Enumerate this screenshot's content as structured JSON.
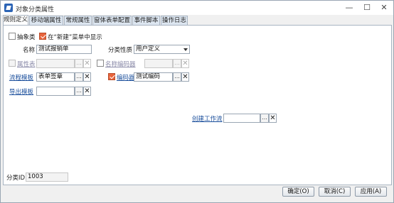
{
  "window": {
    "title": "对象分类属性",
    "minimize_symbol": "—",
    "maximize_symbol": "☐",
    "close_symbol": "✕"
  },
  "tabs": [
    "规则定义",
    "移动端属性",
    "常规属性",
    "窗体表单配置",
    "事件脚本",
    "操作日志"
  ],
  "form": {
    "abstract_label": "抽象类",
    "show_in_new_label": "在“新建”菜单中显示",
    "name_label": "名称",
    "name_value": "测试报销单",
    "category_label": "分类性质",
    "category_value": "用户定义",
    "attr_table_label": "属性表",
    "name_encoder_label": "名称编码器",
    "flow_template_label": "流程模板",
    "flow_template_value": "表单签章",
    "encoder_label": "编码器",
    "encoder_value": "测试编码",
    "export_template_label": "导出模板",
    "create_workflow_label": "创建工作流",
    "class_id_label": "分类ID",
    "class_id_value": "1003",
    "pick_symbol": "...",
    "clear_symbol": "✕"
  },
  "buttons": {
    "ok": "确定(O)",
    "cancel": "取消(C)",
    "apply": "应用(A)"
  },
  "colors": {
    "accent_check": "#e8643c",
    "link": "#1b4f9c"
  }
}
